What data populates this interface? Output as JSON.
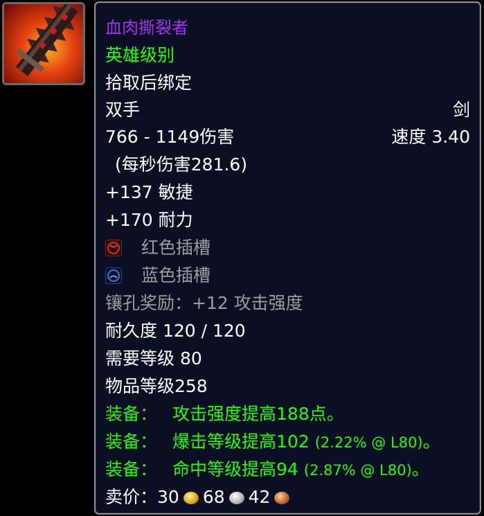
{
  "icon": {
    "name": "two-handed-sword-icon"
  },
  "item": {
    "name": "血肉撕裂者",
    "quality": "英雄级别",
    "binding": "拾取后绑定",
    "slot": "双手",
    "type": "剑",
    "damage": "766 - 1149伤害",
    "speed": "速度 3.40",
    "dps": "(每秒伤害281.6)",
    "agility": "+137 敏捷",
    "stamina": "+170 耐力",
    "socket_red": "红色插槽",
    "socket_blue": "蓝色插槽",
    "socket_bonus": "镶孔奖励：+12 攻击强度",
    "durability": "耐久度 120 / 120",
    "required_level": "需要等级 80",
    "item_level": "物品等级258",
    "equip_label": "装备：",
    "equip_1": "攻击强度提高188点。",
    "equip_2": "爆击等级提高102",
    "equip_2_note": "(2.22% @ L80)",
    "equip_3": "命中等级提高94",
    "equip_3_note": "(2.87% @ L80)",
    "period": "。",
    "sell_label": "卖价：",
    "sell_gold": "30",
    "sell_silver": "68",
    "sell_copper": "42"
  },
  "colors": {
    "epic": "#a335ee",
    "uncommon": "#1eff00",
    "gray": "#9d9d9d",
    "background": "#0b0f23"
  }
}
